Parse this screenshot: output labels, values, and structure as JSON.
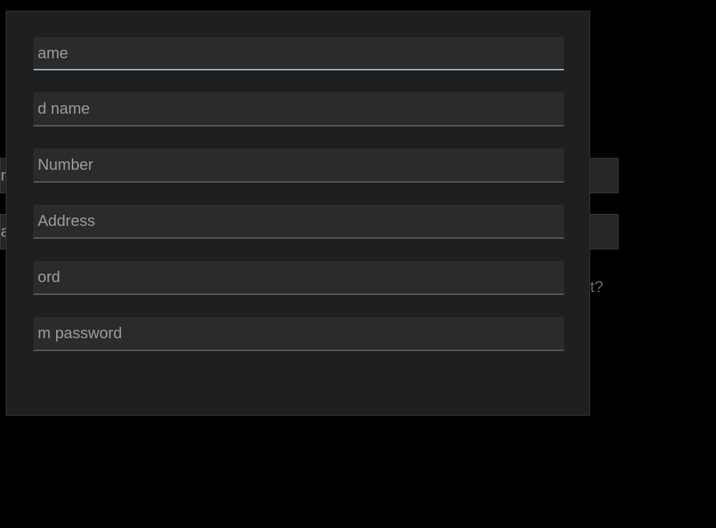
{
  "background": {
    "left_field_1": "m",
    "left_field_2": "a",
    "link_fragment": "t?"
  },
  "dialog": {
    "fields": {
      "first_name": {
        "placeholder": "ame",
        "value": ""
      },
      "second_name": {
        "placeholder": "d name",
        "value": ""
      },
      "number": {
        "placeholder": "Number",
        "value": ""
      },
      "address": {
        "placeholder": "Address",
        "value": ""
      },
      "password": {
        "placeholder": "ord",
        "value": ""
      },
      "confirm_password": {
        "placeholder": "m password",
        "value": ""
      }
    }
  }
}
